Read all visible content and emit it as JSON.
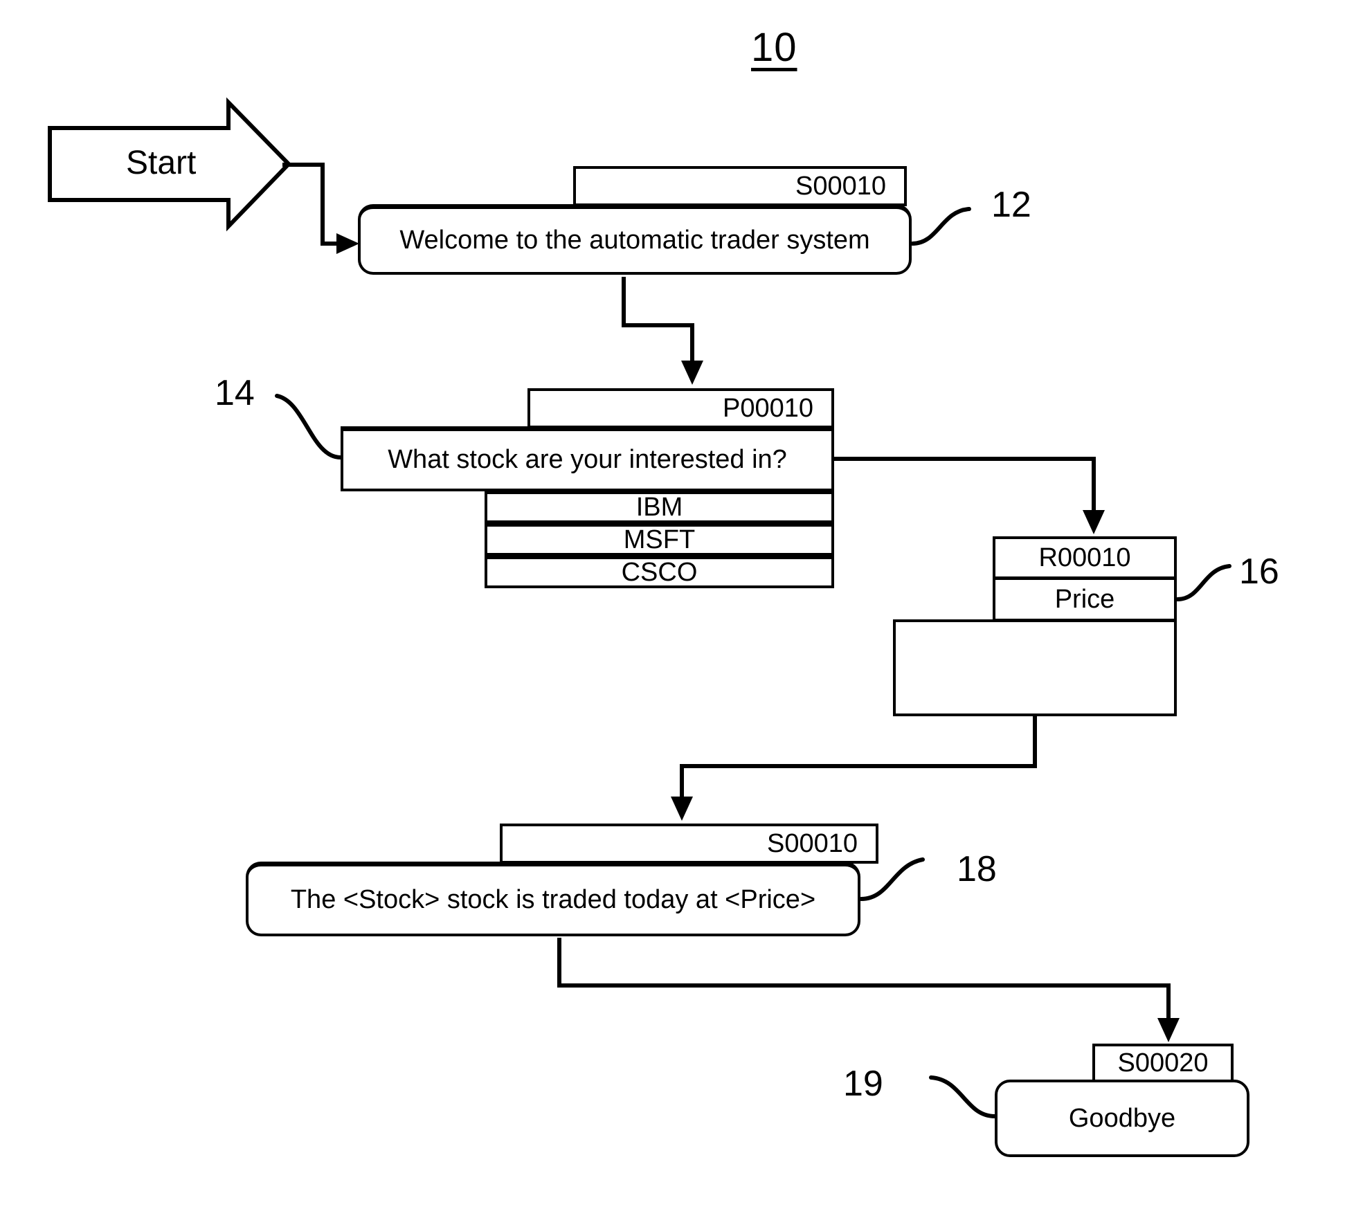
{
  "figure": {
    "number": "10"
  },
  "start": {
    "label": "Start"
  },
  "nodes": {
    "welcome": {
      "ref": "12",
      "header_id": "S00010",
      "text": "Welcome to the automatic trader system"
    },
    "prompt": {
      "ref": "14",
      "header_id": "P00010",
      "text": "What stock are your interested in?",
      "options": [
        "IBM",
        "MSFT",
        "CSCO"
      ]
    },
    "recognition": {
      "ref": "16",
      "header_id": "R00010",
      "text": "Price"
    },
    "result": {
      "ref": "18",
      "header_id": "S00010",
      "text": "The <Stock> stock is traded today at <Price>"
    },
    "goodbye": {
      "ref": "19",
      "header_id": "S00020",
      "text": "Goodbye"
    }
  }
}
